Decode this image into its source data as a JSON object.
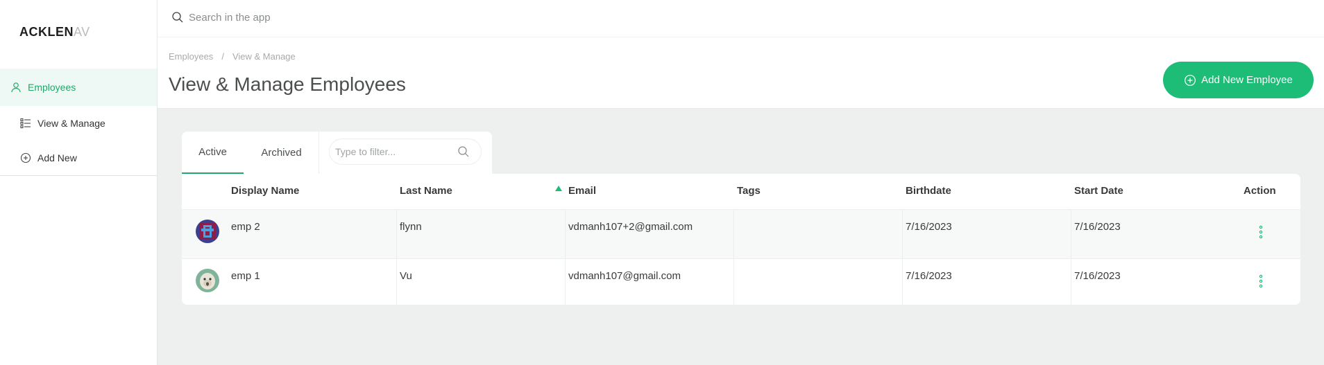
{
  "logo": {
    "main": "ACKLEN",
    "faded": "AV"
  },
  "sidebar": {
    "items": [
      {
        "label": "Employees"
      },
      {
        "label": "View & Manage"
      },
      {
        "label": "Add New"
      }
    ]
  },
  "search": {
    "placeholder": "Search in the app"
  },
  "breadcrumb": {
    "parent": "Employees",
    "separator": "/",
    "current": "View & Manage"
  },
  "page": {
    "title": "View & Manage Employees",
    "add_button_label": "Add New Employee"
  },
  "tabs": [
    {
      "label": "Active"
    },
    {
      "label": "Archived"
    }
  ],
  "filter": {
    "placeholder": "Type to filter..."
  },
  "table": {
    "columns": [
      "Display Name",
      "Last Name",
      "Email",
      "Tags",
      "Birthdate",
      "Start Date",
      "Action"
    ],
    "rows": [
      {
        "display_name": "emp 2",
        "last_name": "flynn",
        "email": "vdmanh107+2@gmail.com",
        "tags": "",
        "birthdate": "7/16/2023",
        "start_date": "7/16/2023"
      },
      {
        "display_name": "emp 1",
        "last_name": "Vu",
        "email": "vdmanh107@gmail.com",
        "tags": "",
        "birthdate": "7/16/2023",
        "start_date": "7/16/2023"
      }
    ]
  },
  "colors": {
    "accent": "#1dbd77",
    "accent_text": "#1fa96a",
    "content_bg": "#eef0f0"
  }
}
